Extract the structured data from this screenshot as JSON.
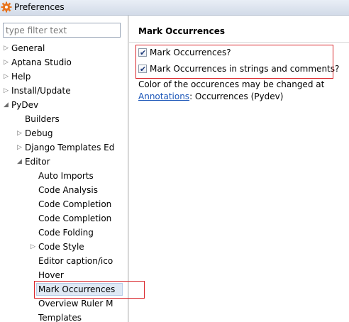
{
  "window": {
    "title": "Preferences",
    "icon": "gear-icon",
    "icon_color": "#e8731c"
  },
  "filter": {
    "placeholder": "type filter text",
    "value": ""
  },
  "tree": {
    "items": [
      {
        "label": "General",
        "level": 0,
        "arrow": "collapsed"
      },
      {
        "label": "Aptana Studio",
        "level": 0,
        "arrow": "collapsed"
      },
      {
        "label": "Help",
        "level": 0,
        "arrow": "collapsed"
      },
      {
        "label": "Install/Update",
        "level": 0,
        "arrow": "collapsed"
      },
      {
        "label": "PyDev",
        "level": 0,
        "arrow": "expanded"
      },
      {
        "label": "Builders",
        "level": 1,
        "arrow": "none"
      },
      {
        "label": "Debug",
        "level": 1,
        "arrow": "collapsed"
      },
      {
        "label": "Django Templates Ed",
        "level": 1,
        "arrow": "collapsed"
      },
      {
        "label": "Editor",
        "level": 1,
        "arrow": "expanded"
      },
      {
        "label": "Auto Imports",
        "level": 2,
        "arrow": "none"
      },
      {
        "label": "Code Analysis",
        "level": 2,
        "arrow": "none"
      },
      {
        "label": "Code Completion",
        "level": 2,
        "arrow": "none"
      },
      {
        "label": "Code Completion",
        "level": 2,
        "arrow": "none"
      },
      {
        "label": "Code Folding",
        "level": 2,
        "arrow": "none"
      },
      {
        "label": "Code Style",
        "level": 2,
        "arrow": "collapsed"
      },
      {
        "label": "Editor caption/ico",
        "level": 2,
        "arrow": "none"
      },
      {
        "label": "Hover",
        "level": 2,
        "arrow": "none"
      },
      {
        "label": "Mark Occurrences",
        "level": 2,
        "arrow": "none",
        "selected": true
      },
      {
        "label": "Overview Ruler M",
        "level": 2,
        "arrow": "none"
      },
      {
        "label": "Templates",
        "level": 2,
        "arrow": "none"
      }
    ]
  },
  "page": {
    "title": "Mark Occurrences",
    "options": [
      {
        "label": "Mark Occurrences?",
        "checked": true
      },
      {
        "label": "Mark Occurrences in strings and comments?",
        "checked": true
      }
    ],
    "note_line1": "Color of the occurences may be changed at",
    "note_link": "Annotations",
    "note_rest": ": Occurrences (Pydev)"
  },
  "colors": {
    "highlight": "#d9262b",
    "link": "#1a55b8",
    "selection_bg": "#dfe9f5"
  }
}
